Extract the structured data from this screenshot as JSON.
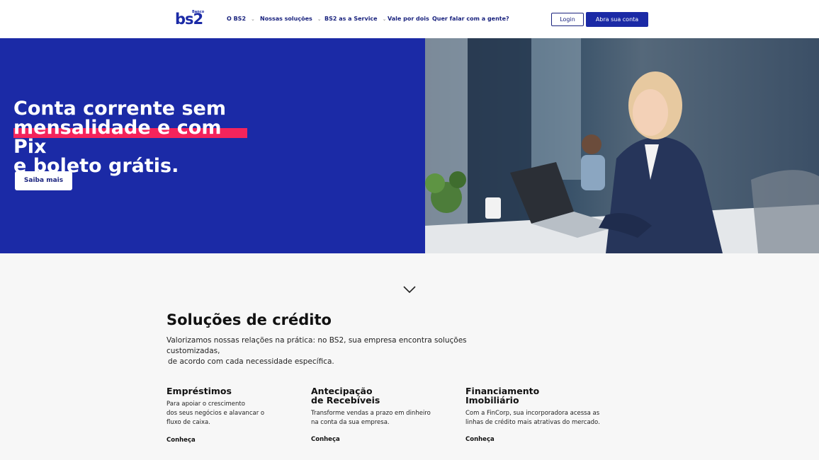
{
  "header": {
    "logo_small": "Banco",
    "logo_big": "bs2",
    "nav": [
      {
        "label": "O BS2",
        "has_dropdown": true
      },
      {
        "label": "Nossas soluções",
        "has_dropdown": true
      },
      {
        "label": "BS2 as a Service",
        "has_dropdown": true
      },
      {
        "label": "Vale por dois",
        "has_dropdown": false
      },
      {
        "label": "Quer falar com a gente?",
        "has_dropdown": false
      }
    ],
    "login_label": "Login",
    "open_account_label": "Abra sua conta"
  },
  "hero": {
    "line1": "Conta corrente sem",
    "line2": "mensalidade e com Pix",
    "line3": "e boleto grátis.",
    "cta_label": "Saiba mais",
    "colors": {
      "background": "#1b2aa6",
      "highlight": "#f4245c"
    }
  },
  "credit": {
    "title": "Soluções de crédito",
    "desc_line1": "Valorizamos nossas relações na prática: no BS2, sua empresa encontra soluções customizadas,",
    "desc_line2": "de acordo com cada necessidade específica.",
    "cards": [
      {
        "title_line1": "Empréstimos",
        "title_line2": "",
        "text_lines": [
          "Para apoiar o crescimento",
          "dos seus negócios e alavancar o",
          "fluxo de caixa."
        ],
        "link": "Conheça"
      },
      {
        "title_line1": "Antecipação",
        "title_line2": "de Recebíveis",
        "text_lines": [
          "Transforme vendas a prazo em dinheiro",
          "na conta da sua empresa."
        ],
        "link": "Conheça"
      },
      {
        "title_line1": "Financiamento",
        "title_line2": "Imobiliário",
        "text_lines": [
          "Com a FinCorp, sua incorporadora acessa as",
          "linhas de crédito mais atrativas do mercado."
        ],
        "link": "Conheça"
      }
    ]
  }
}
